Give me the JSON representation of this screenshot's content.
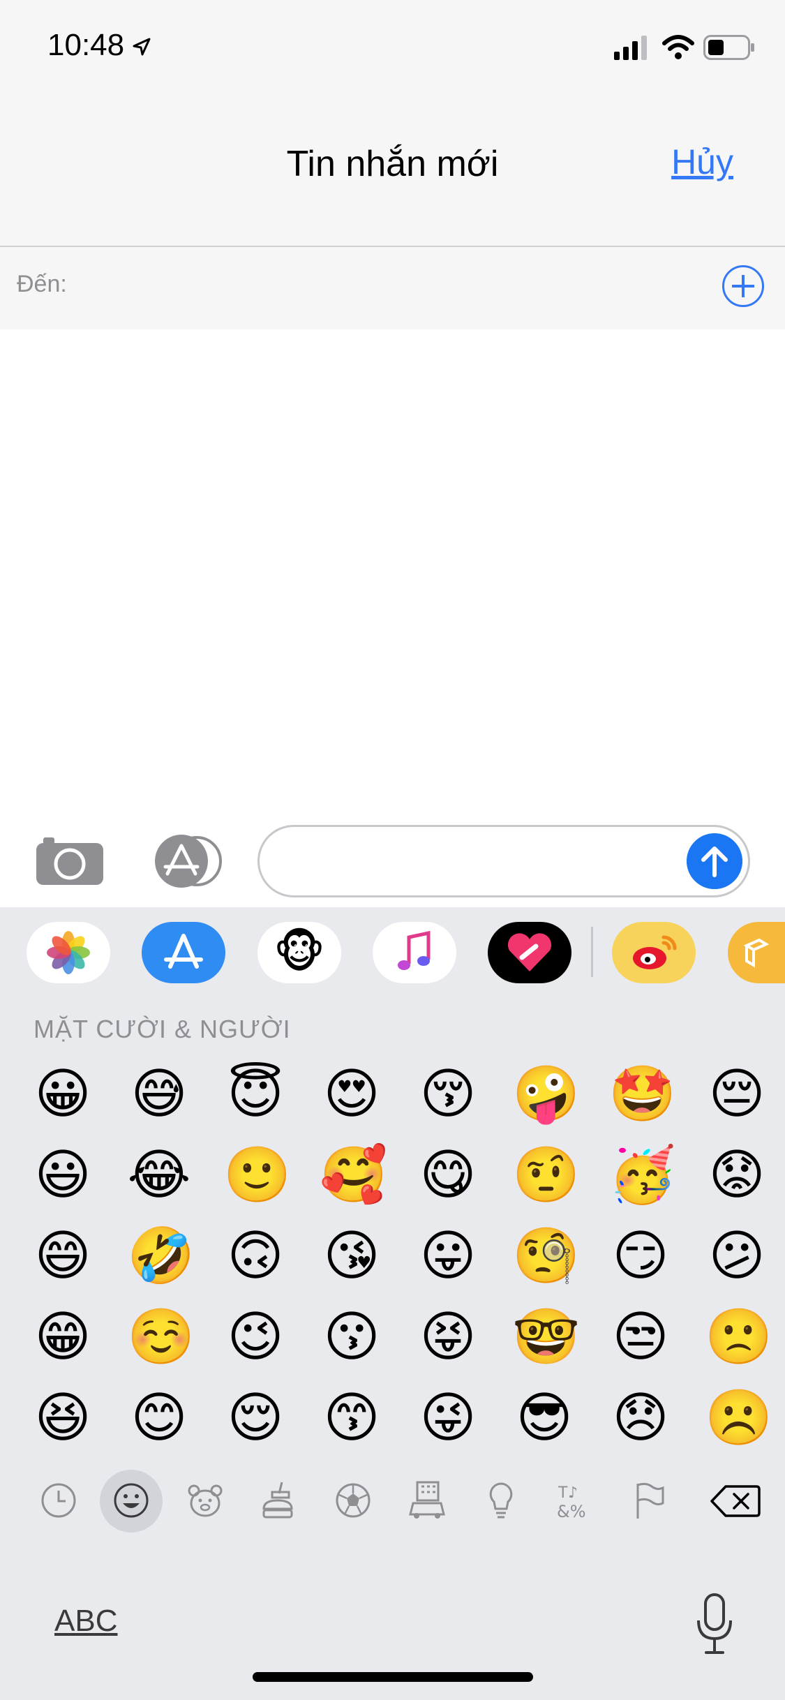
{
  "status_bar": {
    "time": "10:48"
  },
  "nav": {
    "title": "Tin nhắn mới",
    "cancel_label": "Hủy"
  },
  "to_field": {
    "label": "Đến:"
  },
  "compose": {
    "input_value": ""
  },
  "app_drawer": {
    "apps": [
      "photos-icon",
      "app-store-icon",
      "animoji-monkey-icon",
      "music-icon",
      "digital-touch-icon",
      "weibo-icon",
      "yellow-app-icon"
    ]
  },
  "emoji_keyboard": {
    "section_title": "MẶT CƯỜI & NGƯỜI",
    "rows": [
      [
        "😀",
        "😅",
        "😇",
        "😍",
        "😚",
        "🤪",
        "🤩",
        "😔"
      ],
      [
        "😃",
        "😂",
        "🙂",
        "🥰",
        "😋",
        "🤨",
        "🥳",
        "😟"
      ],
      [
        "😄",
        "🤣",
        "🙃",
        "😘",
        "😛",
        "🧐",
        "😏",
        "😕"
      ],
      [
        "😁",
        "☺️",
        "😉",
        "😗",
        "😝",
        "🤓",
        "😒",
        "🙁"
      ],
      [
        "😆",
        "😊",
        "😌",
        "😙",
        "😜",
        "😎",
        "😞",
        "☹️"
      ]
    ],
    "categories": [
      "recent-icon",
      "smileys-icon",
      "animals-icon",
      "food-icon",
      "activity-icon",
      "travel-icon",
      "objects-icon",
      "symbols-icon",
      "flags-icon",
      "delete-icon"
    ],
    "selected_category": "smileys-icon",
    "abc_label": "ABC"
  },
  "colors": {
    "accent": "#3478f6",
    "send": "#1a76f2",
    "keyboard_bg": "#e9eaee",
    "nav_bg": "#f6f6f7"
  }
}
